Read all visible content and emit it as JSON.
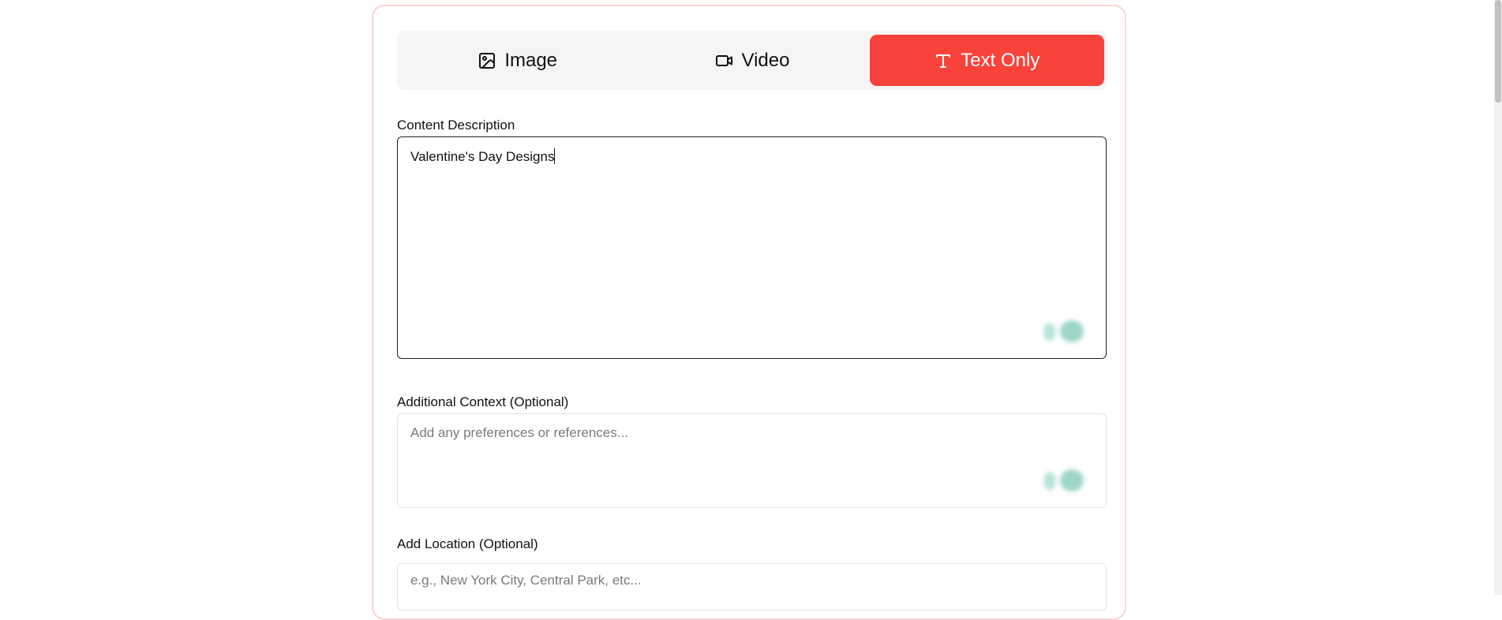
{
  "tabs": [
    {
      "label": "Image",
      "icon": "image-icon",
      "active": false
    },
    {
      "label": "Video",
      "icon": "video-icon",
      "active": false
    },
    {
      "label": "Text Only",
      "icon": "text-icon",
      "active": true
    }
  ],
  "colors": {
    "accent": "#f9423a",
    "card_border": "#fbd5d5",
    "tab_bar_bg": "#f5f5f5"
  },
  "content_description": {
    "label": "Content Description",
    "value": "Valentine's Day Designs"
  },
  "additional_context": {
    "label": "Additional Context (Optional)",
    "placeholder": "Add any preferences or references..."
  },
  "location": {
    "label": "Add Location (Optional)",
    "placeholder": "e.g., New York City, Central Park, etc..."
  }
}
